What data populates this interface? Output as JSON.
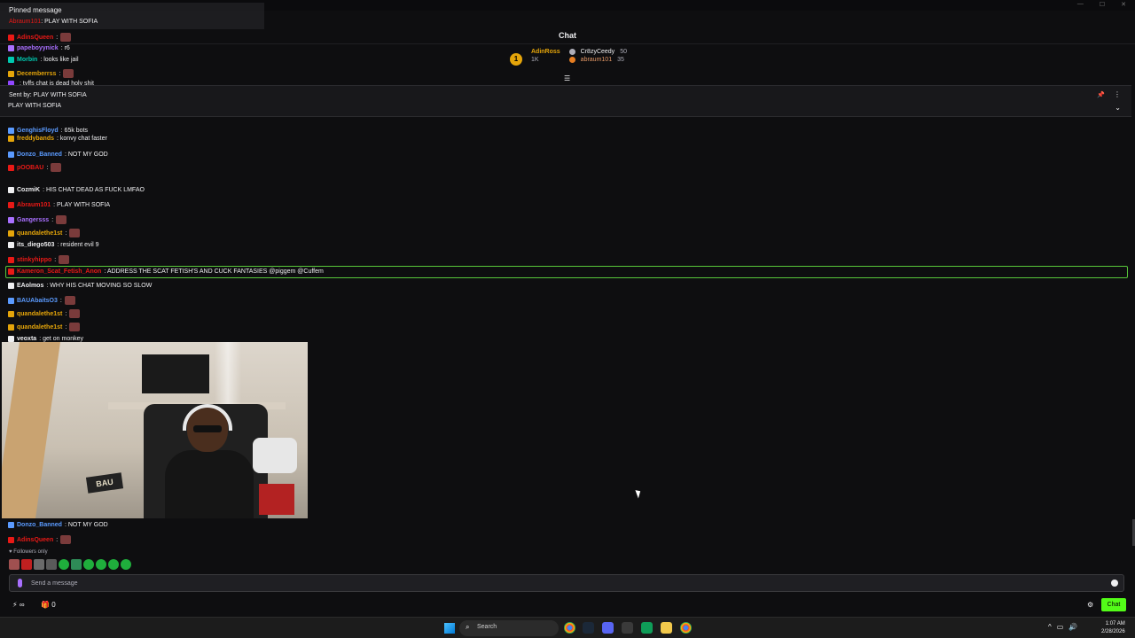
{
  "header": {
    "title": "Chat"
  },
  "leaderboard": {
    "rank": "1",
    "top_name": "AdinRoss",
    "top_sub": "1K",
    "entries": [
      {
        "name": "Cr8zyCeedy",
        "value": "50"
      },
      {
        "name": "abraum101",
        "value": "35"
      }
    ]
  },
  "pinned_overlay": {
    "title": "Pinned message",
    "user": "Abraum101",
    "text": ": PLAY WITH SOFIA"
  },
  "pinned": {
    "sent_by": "Sent by:",
    "sent_text": "PLAY WITH SOFIA",
    "text": "PLAY WITH SOFIA"
  },
  "messages": [
    {
      "user": "AdinsQueen",
      "color": "#e91916",
      "text": ":"
    },
    {
      "user": "papeboyynick",
      "color": "#a970ff",
      "text": ": r6"
    },
    {
      "user": "Morbin",
      "color": "#00c8af",
      "text": ": looks like jail"
    },
    {
      "user": "Decemberrss",
      "color": "#e5a50a",
      "text": ":"
    },
    {
      "user": "",
      "color": "#9147ff",
      "text": ": tyffs chat is dead holy shit"
    },
    {
      "user": "GenghisFloyd",
      "color": "#5b9bff",
      "text": ": 65k bots"
    },
    {
      "user": "freddybands",
      "color": "#e5a50a",
      "text": ": konvy chat faster"
    },
    {
      "user": "Donzo_Banned",
      "color": "#5b9bff",
      "text": ": NOT MY GOD"
    },
    {
      "user": "pOOBAU",
      "color": "#e91916",
      "text": ":"
    },
    {
      "user": "CozmiK",
      "color": "#efeff1",
      "text": ": HIS CHAT DEAD AS FUCK LMFAO"
    },
    {
      "user": "Abraum101",
      "color": "#e91916",
      "text": ": PLAY WITH SOFIA"
    },
    {
      "user": "Gangersss",
      "color": "#a970ff",
      "text": ":"
    },
    {
      "user": "quandalethe1st",
      "color": "#e5a50a",
      "text": ":"
    },
    {
      "user": "its_diego503",
      "color": "#efeff1",
      "text": ": resident evil 9"
    },
    {
      "user": "stinkyhippo",
      "color": "#e91916",
      "text": ":"
    },
    {
      "user": "Kameron_Scat_Fetish_Anon",
      "color": "#e91916",
      "text": ": ADDRESS THE SCAT FETISH'S AND CUCK FANTASIES @piggem @Cuffem"
    },
    {
      "user": "EAolmos",
      "color": "#efeff1",
      "text": ": WHY HIS CHAT MOVING SO SLOW"
    },
    {
      "user": "BAUAbaitsO3",
      "color": "#5b9bff",
      "text": ":"
    },
    {
      "user": "quandalethe1st",
      "color": "#e5a50a",
      "text": ":"
    },
    {
      "user": "quandalethe1st",
      "color": "#e5a50a",
      "text": ":"
    },
    {
      "user": "veoxta",
      "color": "#efeff1",
      "text": ": get on monkey"
    },
    {
      "user": "Donzo_Banned",
      "color": "#5b9bff",
      "text": ": NOT MY GOD"
    },
    {
      "user": "AdinsQueen",
      "color": "#e91916",
      "text": ":"
    }
  ],
  "cam": {
    "box_text": "BAU"
  },
  "footer": {
    "followers": "Followers only",
    "placeholder": "Send a message",
    "points": "∞",
    "gifts": "0",
    "chat_button": "Chat"
  },
  "taskbar": {
    "search_label": "Search",
    "time": "1:07 AM",
    "date": "2/28/2026"
  }
}
